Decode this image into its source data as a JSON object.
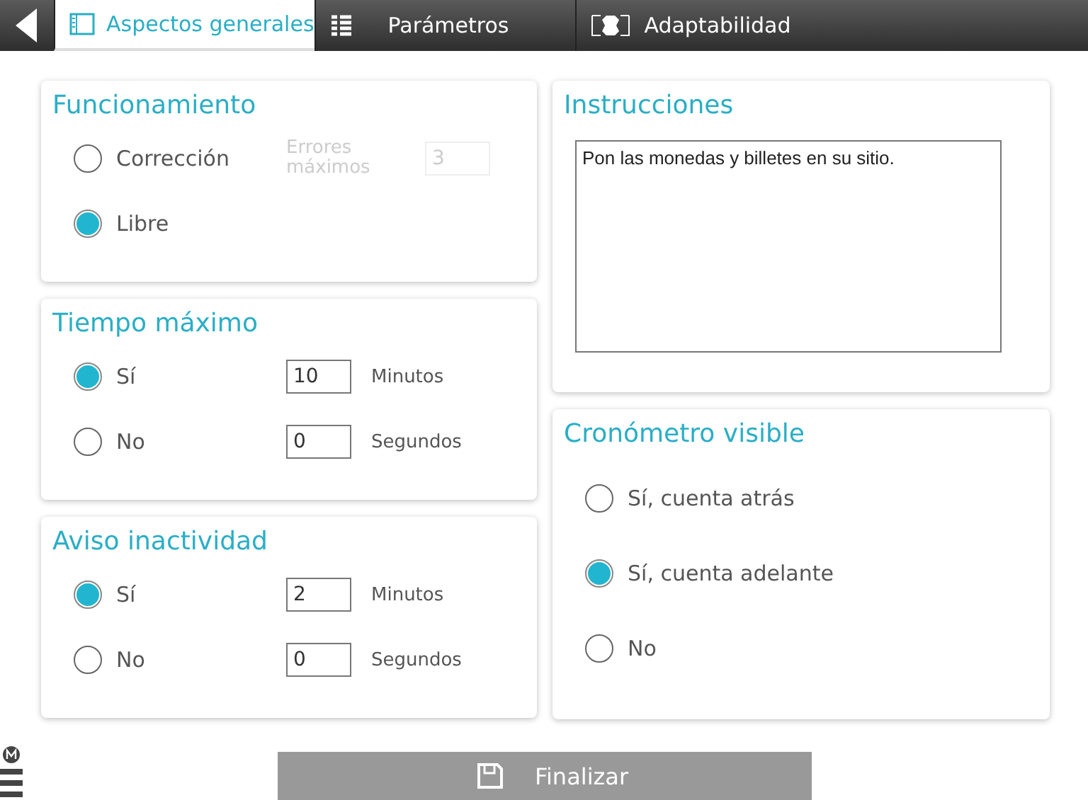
{
  "tabs": [
    {
      "label": "Aspectos generales",
      "selected": true
    },
    {
      "label": "Parámetros",
      "selected": false
    },
    {
      "label": "Adaptabilidad",
      "selected": false
    }
  ],
  "funcionamiento": {
    "title": "Funcionamiento",
    "options": [
      {
        "label": "Corrección",
        "selected": false
      },
      {
        "label": "Libre",
        "selected": true
      }
    ],
    "max_errors": {
      "label": "Errores máximos",
      "value": "3",
      "disabled": true
    }
  },
  "tiempo_maximo": {
    "title": "Tiempo máximo",
    "options": [
      {
        "label": "Sí",
        "selected": true
      },
      {
        "label": "No",
        "selected": false
      }
    ],
    "fields": [
      {
        "value": "10",
        "unit": "Minutos"
      },
      {
        "value": "0",
        "unit": "Segundos"
      }
    ]
  },
  "aviso_inactividad": {
    "title": "Aviso inactividad",
    "options": [
      {
        "label": "Sí",
        "selected": true
      },
      {
        "label": "No",
        "selected": false
      }
    ],
    "fields": [
      {
        "value": "2",
        "unit": "Minutos"
      },
      {
        "value": "0",
        "unit": "Segundos"
      }
    ]
  },
  "instrucciones": {
    "title": "Instrucciones",
    "value": "Pon las monedas y billetes en su sitio."
  },
  "cronometro_visible": {
    "title": "Cronómetro visible",
    "options": [
      {
        "label": "Sí, cuenta atrás",
        "selected": false
      },
      {
        "label": "Sí, cuenta adelante",
        "selected": true
      },
      {
        "label": "No",
        "selected": false
      }
    ]
  },
  "finalizar_button": {
    "label": "Finalizar"
  }
}
